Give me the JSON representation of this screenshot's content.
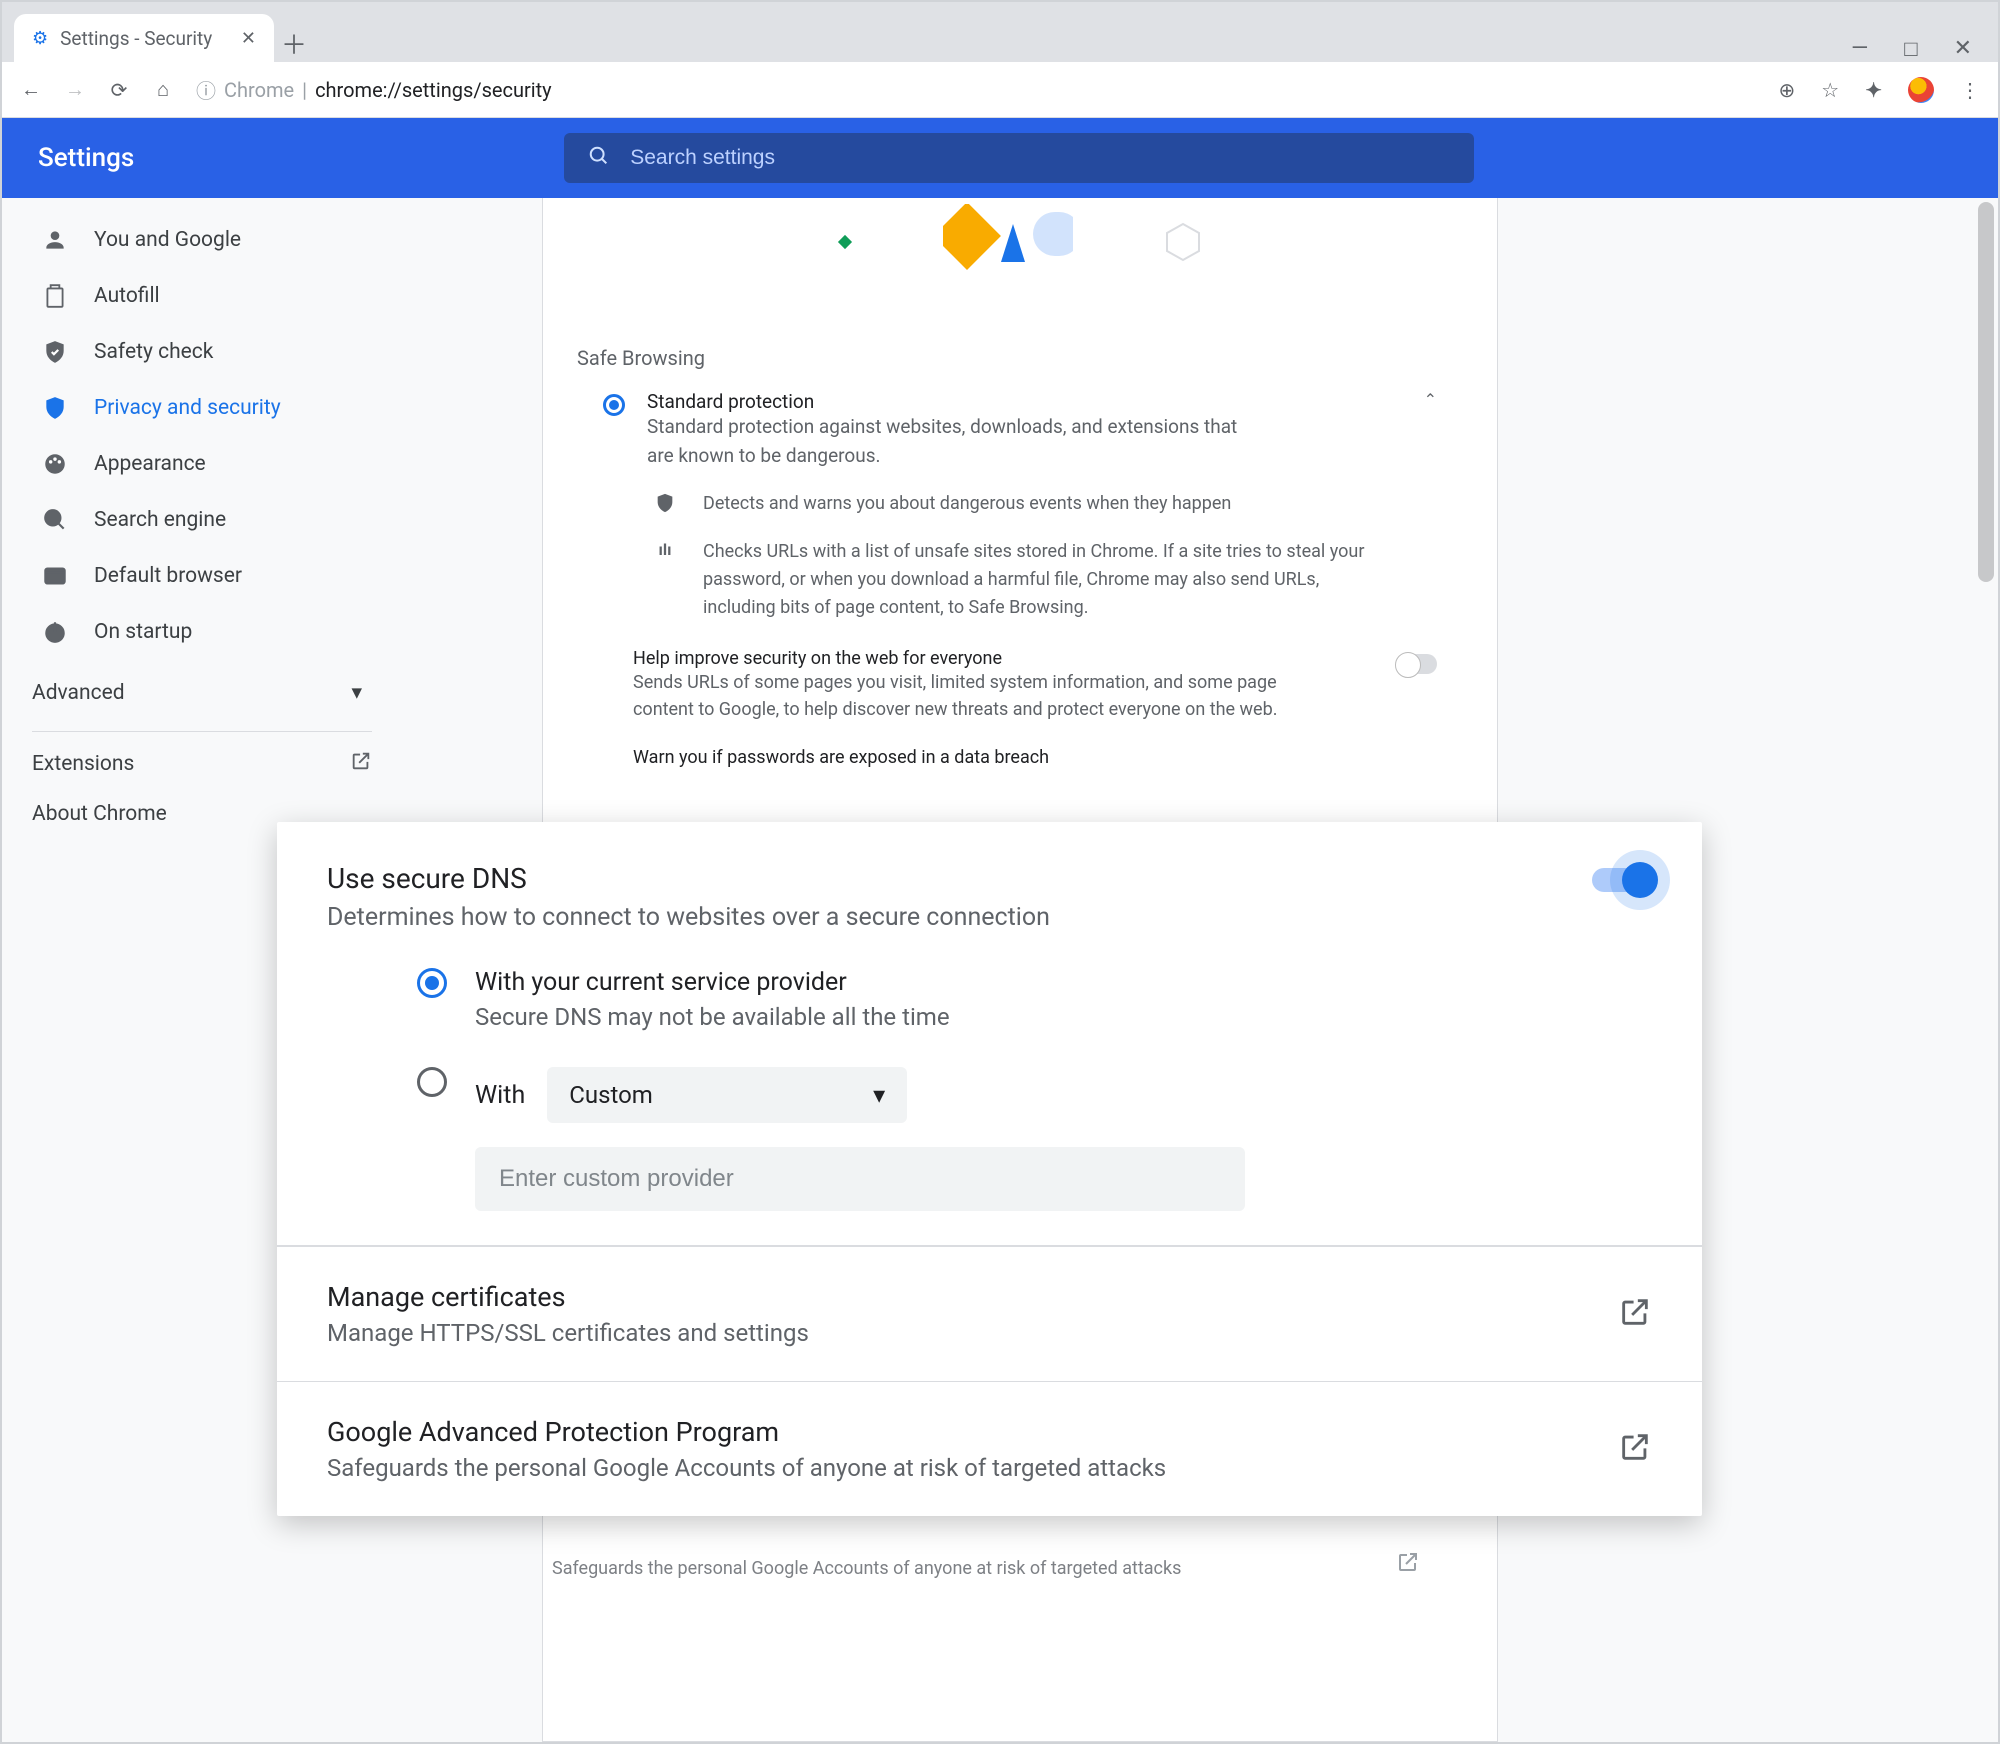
{
  "window": {
    "tab_title": "Settings - Security",
    "url_scheme": "Chrome",
    "url_path": "chrome://settings/security"
  },
  "header": {
    "title": "Settings",
    "search_placeholder": "Search settings"
  },
  "sidebar": {
    "items": [
      {
        "label": "You and Google"
      },
      {
        "label": "Autofill"
      },
      {
        "label": "Safety check"
      },
      {
        "label": "Privacy and security"
      },
      {
        "label": "Appearance"
      },
      {
        "label": "Search engine"
      },
      {
        "label": "Default browser"
      },
      {
        "label": "On startup"
      }
    ],
    "advanced": "Advanced",
    "extensions": "Extensions",
    "about": "About Chrome"
  },
  "main": {
    "section": "Safe Browsing",
    "standard": {
      "title": "Standard protection",
      "desc": "Standard protection against websites, downloads, and extensions that are known to be dangerous."
    },
    "feat1": "Detects and warns you about dangerous events when they happen",
    "feat2": "Checks URLs with a list of unsafe sites stored in Chrome. If a site tries to steal your password, or when you download a harmful file, Chrome may also send URLs, including bits of page content, to Safe Browsing.",
    "help": {
      "title": "Help improve security on the web for everyone",
      "desc": "Sends URLs of some pages you visit, limited system information, and some page content to Google, to help discover new threats and protect everyone on the web."
    },
    "warn": "Warn you if passwords are exposed in a data breach",
    "adv_prog_sub_bg": "Safeguards the personal Google Accounts of anyone at risk of targeted attacks"
  },
  "overlay": {
    "dns": {
      "title": "Use secure DNS",
      "desc": "Determines how to connect to websites over a secure connection",
      "opt1_t": "With your current service provider",
      "opt1_d": "Secure DNS may not be available all the time",
      "opt2_t": "With",
      "dropdown": "Custom",
      "placeholder": "Enter custom provider"
    },
    "certs": {
      "title": "Manage certificates",
      "desc": "Manage HTTPS/SSL certificates and settings"
    },
    "gapp": {
      "title": "Google Advanced Protection Program",
      "desc": "Safeguards the personal Google Accounts of anyone at risk of targeted attacks"
    }
  }
}
